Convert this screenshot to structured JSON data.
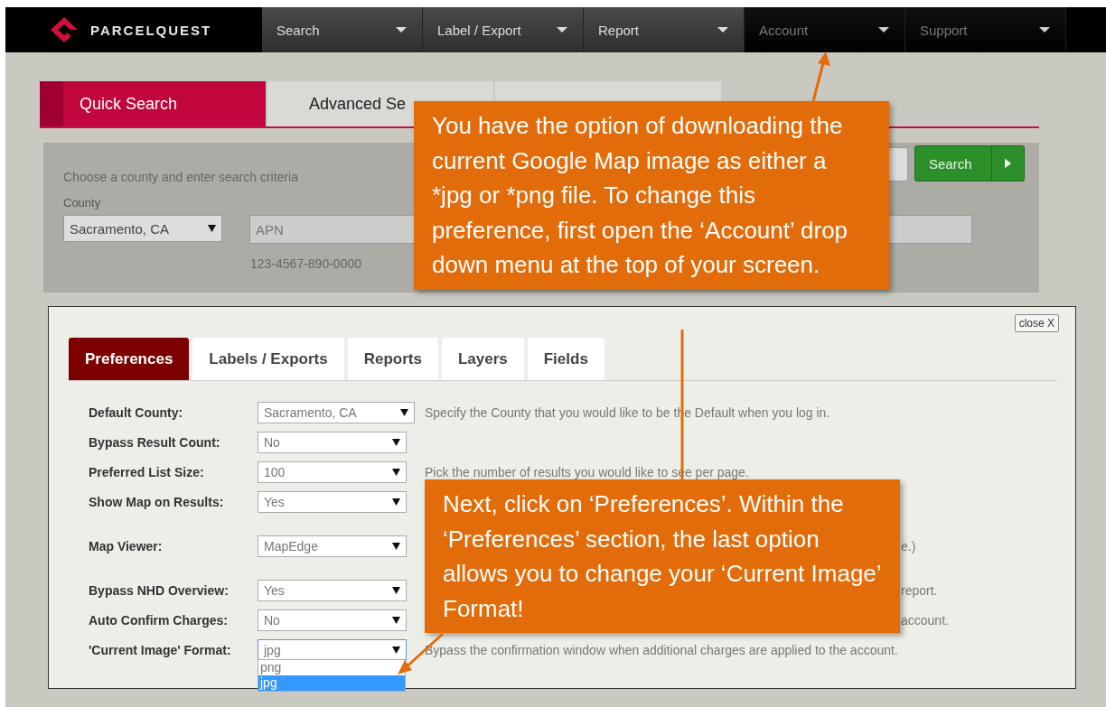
{
  "brand": "PARCELQUEST",
  "nav": [
    {
      "label": "Search",
      "disabled": false
    },
    {
      "label": "Label / Export",
      "disabled": false
    },
    {
      "label": "Report",
      "disabled": false
    },
    {
      "label": "Account",
      "disabled": true
    },
    {
      "label": "Support",
      "disabled": true
    }
  ],
  "search_tabs": [
    {
      "label": "Quick Search",
      "selected": true
    },
    {
      "label": "Advanced Se",
      "selected": false
    },
    {
      "selected": false
    }
  ],
  "search_panel": {
    "intro": "Choose a county and enter search criteria",
    "county_label": "County",
    "county": "Sacramento, CA",
    "apn_placeholder": "APN",
    "apn_hint": "123-4567-890-0000",
    "search_button": "Search"
  },
  "preferences": {
    "close": "close X",
    "tabs": [
      {
        "label": "Preferences",
        "selected": true
      },
      {
        "label": "Labels / Exports",
        "selected": false
      },
      {
        "label": "Reports",
        "selected": false
      },
      {
        "label": "Layers",
        "selected": false
      },
      {
        "label": "Fields",
        "selected": false
      }
    ],
    "rows": [
      {
        "label": "Default County:",
        "value": "Sacramento, CA",
        "focused": false,
        "description": {
          "text": "Specify the County that you would like to be the Default when you log in.",
          "covered": false
        }
      },
      {
        "label": "Bypass Result Count:",
        "value": "No",
        "focused": false
      },
      {
        "label": "Preferred List Size:",
        "value": "100",
        "focused": false,
        "description": {
          "text": "Pick the number of results you would like to see per page.",
          "covered": false
        }
      },
      {
        "label": "Show Map on Results:",
        "value": "Yes",
        "focused": false
      },
      {
        "label": "Map Viewer:",
        "value": "MapEdge",
        "focused": false,
        "description": {
          "text": "e.)",
          "covered": true
        }
      },
      {
        "label": "Bypass NHD Overview:",
        "value": "Yes",
        "focused": false,
        "description": {
          "text": "report.",
          "covered": true
        }
      },
      {
        "label": "Auto Confirm Charges:",
        "value": "No",
        "focused": false,
        "description": {
          "text": "account.",
          "covered": true
        }
      },
      {
        "label": "'Current Image' Format:",
        "value": "jpg",
        "focused": true,
        "description": {
          "text": "Bypass the confirmation window when additional charges are applied to the account.",
          "covered": false
        },
        "options": [
          {
            "label": "png",
            "selected": false
          },
          {
            "label": "jpg",
            "selected": true
          }
        ]
      }
    ]
  },
  "callouts": [
    {
      "text": "You have the option of downloading the current Google Map image as either a *jpg or *png file. To change this preference, first open the ‘Account’ drop down menu at the top of your screen."
    },
    {
      "text": "Next, click on ‘Preferences’. Within the ‘Preferences’ section, the last option allows you to change your ‘Current Image’ Format!"
    }
  ]
}
